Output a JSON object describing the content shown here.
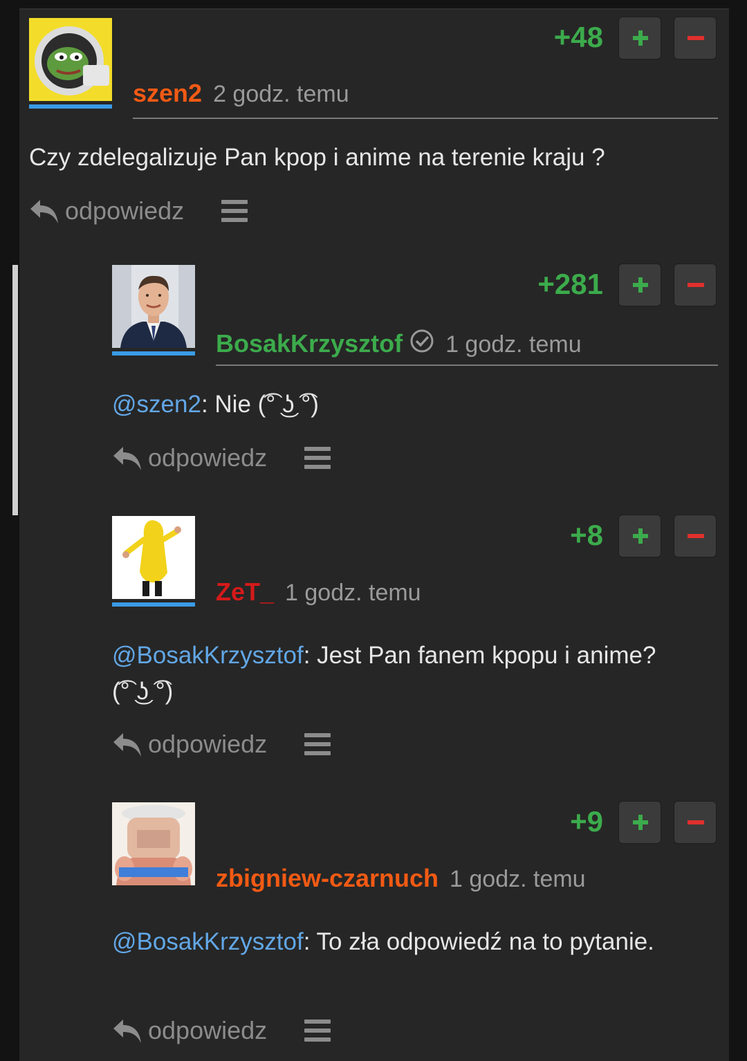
{
  "comments": [
    {
      "username": "szen2",
      "username_color": "#f25a14",
      "timestamp": "2 godz. temu",
      "score": "+48",
      "body_text": "Czy zdelegalizuje Pan kpop i anime na terenie kraju ?",
      "reply_label": "odpowiedz",
      "avatar_icon": "pepe-astronaut-avatar"
    },
    {
      "username": "BosakKrzysztof",
      "username_color": "#3cab4c",
      "verified": true,
      "timestamp": "1 godz. temu",
      "score": "+281",
      "mention": "@szen2",
      "body_text": ": Nie (͡° ͜ʖ ͡°)",
      "reply_label": "odpowiedz",
      "avatar_icon": "man-in-suit-avatar"
    },
    {
      "username": "ZeT_",
      "username_color": "#d41a1a",
      "timestamp": "1 godz. temu",
      "score": "+8",
      "mention": "@BosakKrzysztof",
      "body_text": ": Jest Pan fanem kpopu i anime? (͡° ͜ʖ ͡°)",
      "reply_label": "odpowiedz",
      "avatar_icon": "banana-costume-avatar"
    },
    {
      "username": "zbigniew-czarnuch",
      "username_color": "#f25a14",
      "timestamp": "1 godz. temu",
      "score": "+9",
      "mention": "@BosakKrzysztof",
      "body_text": ": To zła odpowiedź na to pytanie.",
      "reply_label": "odpowiedz",
      "avatar_icon": "meme-face-avatar"
    }
  ]
}
